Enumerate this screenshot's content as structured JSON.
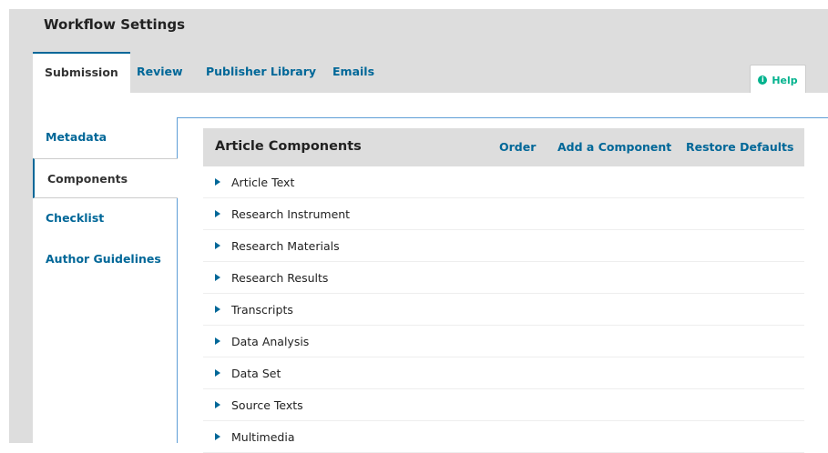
{
  "page": {
    "title": "Workflow Settings"
  },
  "tabs": [
    {
      "label": "Submission",
      "active": true
    },
    {
      "label": "Review"
    },
    {
      "label": "Publisher Library"
    },
    {
      "label": "Emails"
    }
  ],
  "help": {
    "label": "Help",
    "icon": "info-circle-icon"
  },
  "sidebar": {
    "items": [
      {
        "label": "Metadata"
      },
      {
        "label": "Components",
        "active": true
      },
      {
        "label": "Checklist"
      },
      {
        "label": "Author Guidelines"
      }
    ]
  },
  "grid": {
    "title": "Article Components",
    "actions": {
      "order": "Order",
      "add": "Add a Component",
      "restore": "Restore Defaults"
    },
    "rows": [
      "Article Text",
      "Research Instrument",
      "Research Materials",
      "Research Results",
      "Transcripts",
      "Data Analysis",
      "Data Set",
      "Source Texts",
      "Multimedia"
    ]
  },
  "colors": {
    "link": "#006798",
    "help": "#00b28d",
    "header_bg": "#dddddd"
  }
}
